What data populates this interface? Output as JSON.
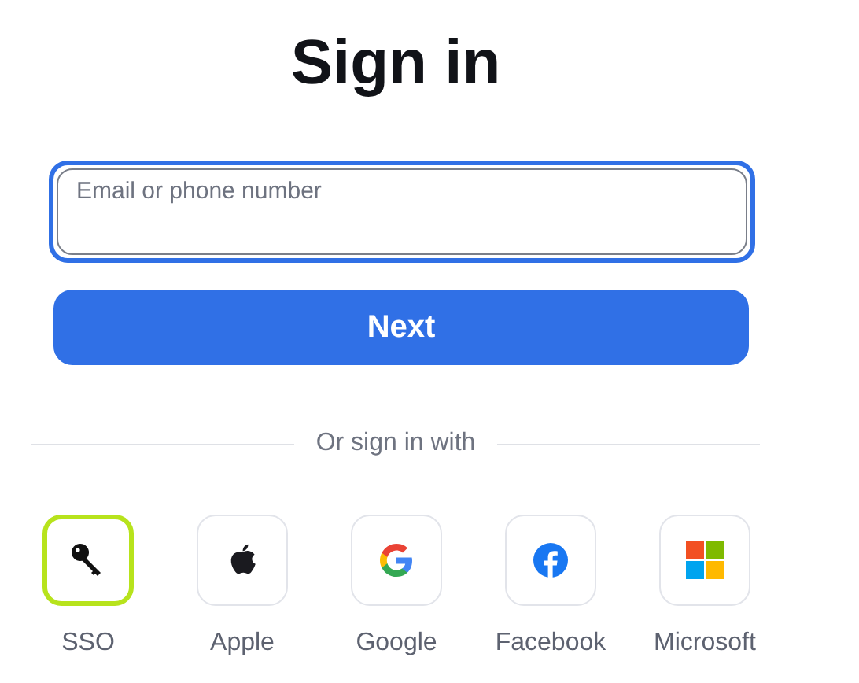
{
  "title": "Sign in",
  "email_field": {
    "placeholder": "Email or phone number",
    "focused": true
  },
  "next_button": {
    "label": "Next"
  },
  "divider": {
    "label": "Or sign in with"
  },
  "providers": [
    {
      "kind": "sso",
      "label": "SSO",
      "focused": true
    },
    {
      "kind": "apple",
      "label": "Apple",
      "focused": false
    },
    {
      "kind": "google",
      "label": "Google",
      "focused": false
    },
    {
      "kind": "facebook",
      "label": "Facebook",
      "focused": false
    },
    {
      "kind": "microsoft",
      "label": "Microsoft",
      "focused": false
    }
  ]
}
